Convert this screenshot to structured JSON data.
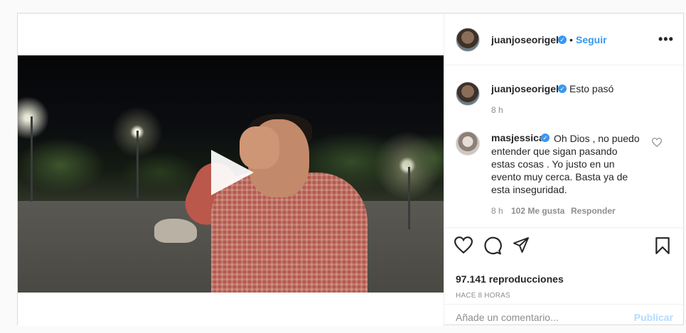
{
  "post": {
    "username": "juanjoseorigel",
    "follow_label": "Seguir",
    "separator": "•",
    "more_label": "•••",
    "caption": "Esto pasó",
    "caption_time": "8 h"
  },
  "comment": {
    "username": "masjessica",
    "text": "Oh Dios , no puedo entender que sigan pasando estas cosas . Yo justo en un evento muy cerca. Basta ya de esta inseguridad.",
    "time": "8 h",
    "likes": "102 Me gusta",
    "reply_label": "Responder"
  },
  "stats": {
    "views": "97.141 reproducciones",
    "posted": "HACE 8 HORAS"
  },
  "add_comment": {
    "placeholder": "Añade un comentario...",
    "post_label": "Publicar"
  },
  "icons": {
    "verified": "verified-badge-icon",
    "more": "more-options-icon",
    "like": "heart-icon",
    "comment": "comment-bubble-icon",
    "share": "paper-plane-icon",
    "save": "bookmark-icon",
    "play": "play-icon"
  },
  "colors": {
    "link_blue": "#3897f0",
    "text": "#262626",
    "muted": "#8e8e8e",
    "border": "#dbdbdb"
  }
}
